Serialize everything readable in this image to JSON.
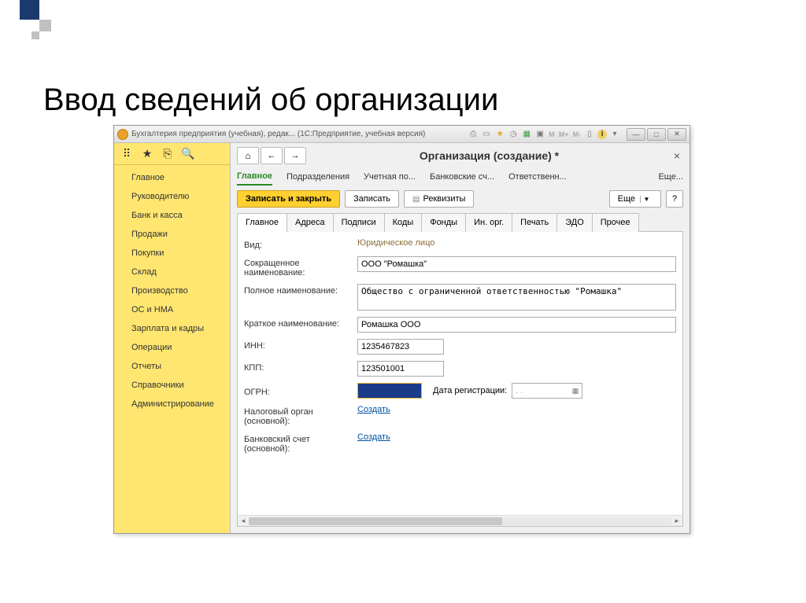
{
  "slide_title": "Ввод сведений об организации",
  "titlebar": {
    "text": "Бухгалтерия предприятия (учебная), редак...  (1С:Предприятие, учебная версия)"
  },
  "sidebar": {
    "items": [
      "Главное",
      "Руководителю",
      "Банк и касса",
      "Продажи",
      "Покупки",
      "Склад",
      "Производство",
      "ОС и НМА",
      "Зарплата и кадры",
      "Операции",
      "Отчеты",
      "Справочники",
      "Администрирование"
    ]
  },
  "page": {
    "title": "Организация (создание) *"
  },
  "section_tabs": [
    "Главное",
    "Подразделения",
    "Учетная по...",
    "Банковские сч...",
    "Ответственн..."
  ],
  "section_more": "Еще...",
  "actions": {
    "write_close": "Записать и закрыть",
    "write": "Записать",
    "requisites": "Реквизиты",
    "more": "Еще",
    "help": "?"
  },
  "inner_tabs": [
    "Главное",
    "Адреса",
    "Подписи",
    "Коды",
    "Фонды",
    "Ин. орг.",
    "Печать",
    "ЭДО",
    "Прочее"
  ],
  "form": {
    "vid_label": "Вид:",
    "vid_value": "Юридическое лицо",
    "short_name_label": "Сокращенное наименование:",
    "short_name_value": "ООО \"Ромашка\"",
    "full_name_label": "Полное наименование:",
    "full_name_value": "Общество с ограниченной ответственностью \"Ромашка\"",
    "brief_name_label": "Краткое наименование:",
    "brief_name_value": "Ромашка ООО",
    "inn_label": "ИНН:",
    "inn_value": "1235467823",
    "kpp_label": "КПП:",
    "kpp_value": "123501001",
    "ogrn_label": "ОГРН:",
    "reg_date_label": "Дата регистрации:",
    "reg_date_value": "  .  .",
    "tax_label": "Налоговый орган (основной):",
    "tax_link": "Создать",
    "bank_label": "Банковский счет (основной):",
    "bank_link": "Создать"
  }
}
